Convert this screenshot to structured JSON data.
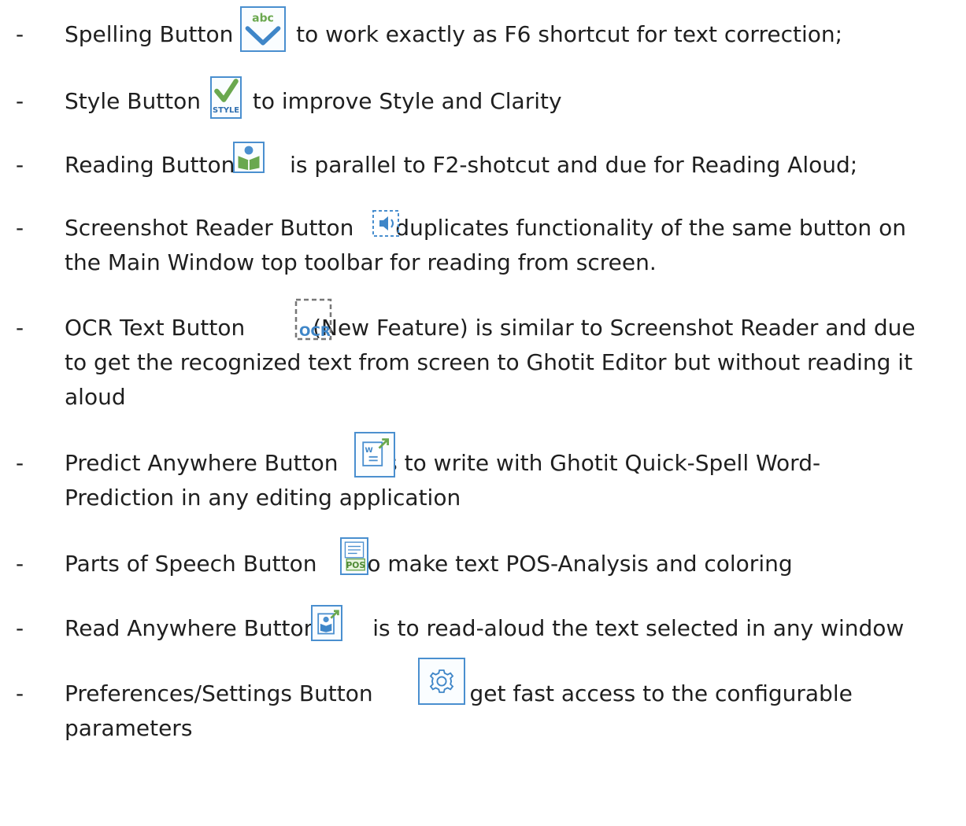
{
  "items": [
    {
      "pre": "Spelling Button",
      "post": "to work exactly as F6 shortcut for text correction;",
      "icon_text": "abc",
      "icon": "spelling-icon"
    },
    {
      "pre": "Style Button",
      "post": "to improve Style and Clarity",
      "icon_text": "STYLE",
      "icon": "style-icon"
    },
    {
      "pre": "Reading Button",
      "post": "is parallel to F2-shotcut and due for Reading Aloud;",
      "icon": "reading-icon"
    },
    {
      "pre": "Screenshot Reader Button",
      "post": "duplicates functionality of the same button on",
      "post2": "the Main Window top toolbar for reading from screen.",
      "icon": "screenshot-reader-icon"
    },
    {
      "pre": "OCR Text Button",
      "post": "(New Feature) is similar to Screenshot Reader and due",
      "post2": "to get the recognized text from screen to Ghotit Editor but without reading it",
      "post3": "aloud",
      "icon_text": "OCR",
      "icon": "ocr-icon"
    },
    {
      "pre": "Predict Anywhere Button",
      "post": "is to write with Ghotit Quick-Spell Word-",
      "post2": "Prediction in any editing application",
      "icon_text": "W",
      "icon": "predict-anywhere-icon"
    },
    {
      "pre": "Parts of Speech Button",
      "post": "to make text POS-Analysis and coloring",
      "icon_text": "POS",
      "icon": "parts-of-speech-icon"
    },
    {
      "pre": "Read Anywhere Button",
      "post": "is to read-aloud the text selected in any window",
      "icon": "read-anywhere-icon"
    },
    {
      "pre": "Preferences/Settings Button",
      "post": "to get fast access to the configurable",
      "post2": "parameters",
      "icon": "gear-icon"
    }
  ],
  "dash": "-",
  "colors": {
    "icon_border": "#4a8fcf",
    "icon_green": "#6aa84f",
    "text": "#1f1f1f"
  }
}
